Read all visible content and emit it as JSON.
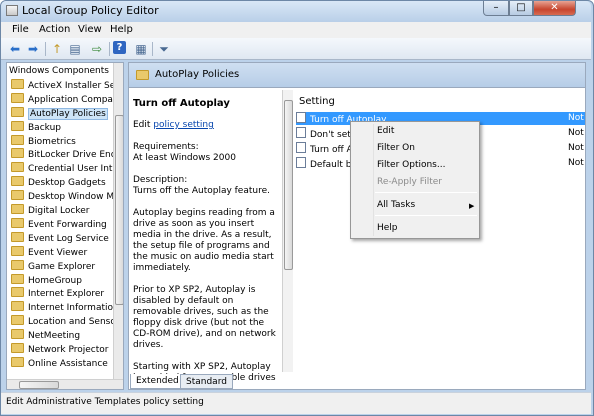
{
  "window": {
    "title": "Local Group Policy Editor",
    "minimize": "–",
    "maximize": "□",
    "close": "✕"
  },
  "menu": [
    "File",
    "Action",
    "View",
    "Help"
  ],
  "toolbar": {
    "icons": [
      "back-arrow-icon",
      "forward-arrow-icon",
      "up-folder-icon",
      "show-hide-tree-icon",
      "export-list-icon",
      "help-icon",
      "properties-icon",
      "filter-icon"
    ],
    "glyphs": [
      "⬅",
      "➡",
      "↑",
      "▤",
      "⇨",
      "?",
      "▦",
      "⏷"
    ]
  },
  "tree": {
    "items": [
      {
        "label": "Windows Components",
        "root": true
      },
      {
        "label": "ActiveX Installer Serv"
      },
      {
        "label": "Application Compat"
      },
      {
        "label": "AutoPlay Policies",
        "selected": true
      },
      {
        "label": "Backup"
      },
      {
        "label": "Biometrics"
      },
      {
        "label": "BitLocker Drive Encry"
      },
      {
        "label": "Credential User Inter"
      },
      {
        "label": "Desktop Gadgets"
      },
      {
        "label": "Desktop Window Ma"
      },
      {
        "label": "Digital Locker"
      },
      {
        "label": "Event Forwarding"
      },
      {
        "label": "Event Log Service"
      },
      {
        "label": "Event Viewer"
      },
      {
        "label": "Game Explorer"
      },
      {
        "label": "HomeGroup"
      },
      {
        "label": "Internet Explorer"
      },
      {
        "label": "Internet Information"
      },
      {
        "label": "Location and Sensor"
      },
      {
        "label": "NetMeeting"
      },
      {
        "label": "Network Projector"
      },
      {
        "label": "Online Assistance"
      }
    ]
  },
  "main": {
    "header": "AutoPlay Policies",
    "description": {
      "title": "Turn off Autoplay",
      "edit_prefix": "Edit ",
      "edit_link": "policy setting",
      "requirements_label": "Requirements:",
      "requirements_value": "At least Windows 2000",
      "description_label": "Description:",
      "description_value": "Turns off the Autoplay feature.",
      "para1": "Autoplay begins reading from a drive as soon as you insert media in the drive. As a result, the setup file of programs and the music on audio media start immediately.",
      "para2": "Prior to XP SP2, Autoplay is disabled by default on removable drives, such as the floppy disk drive (but not the CD-ROM drive), and on network drives.",
      "para3": "Starting with XP SP2, Autoplay is enabled for removable drives as"
    },
    "column_header": "Setting",
    "rows": [
      {
        "label": "Turn off Autoplay",
        "state": "Not",
        "selected": true
      },
      {
        "label": "Don't set t",
        "state": "Not"
      },
      {
        "label": "Turn off A",
        "state": "Not"
      },
      {
        "label": "Default be",
        "state": "Not"
      }
    ]
  },
  "context_menu": {
    "edit": "Edit",
    "filter_on": "Filter On",
    "filter_options": "Filter Options...",
    "reapply_filter": "Re-Apply Filter",
    "all_tasks": "All Tasks",
    "help": "Help"
  },
  "tabs": [
    "Extended",
    "Standard"
  ],
  "status": "Edit Administrative Templates policy setting"
}
